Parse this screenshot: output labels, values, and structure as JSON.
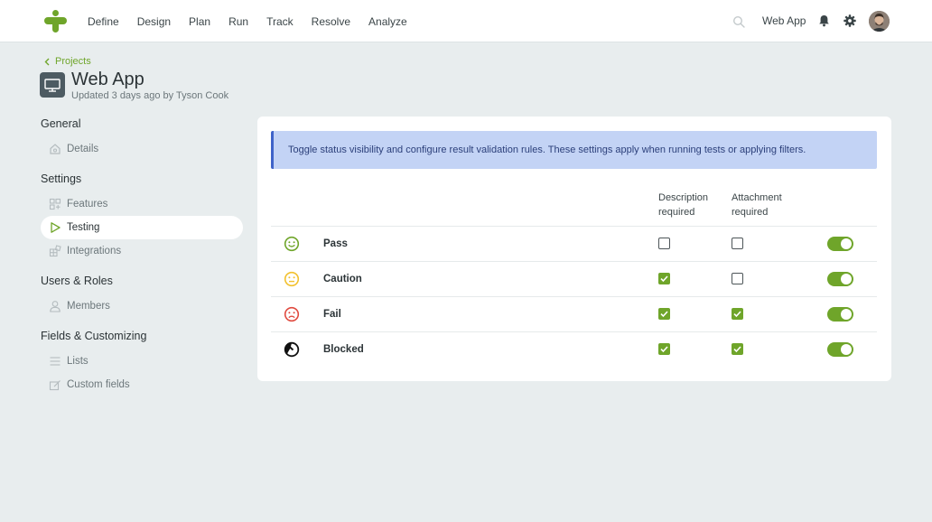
{
  "topnav": {
    "items": [
      "Define",
      "Design",
      "Plan",
      "Run",
      "Track",
      "Resolve",
      "Analyze"
    ],
    "app_label": "Web App"
  },
  "header": {
    "breadcrumb": "Projects",
    "title": "Web App",
    "subtitle": "Updated 3 days ago by Tyson Cook"
  },
  "sidebar": {
    "sections": [
      {
        "title": "General",
        "items": [
          {
            "label": "Details",
            "icon": "home-icon"
          }
        ]
      },
      {
        "title": "Settings",
        "items": [
          {
            "label": "Features",
            "icon": "features-icon"
          },
          {
            "label": "Testing",
            "icon": "play-icon",
            "active": true
          },
          {
            "label": "Integrations",
            "icon": "integrations-icon"
          }
        ]
      },
      {
        "title": "Users & Roles",
        "items": [
          {
            "label": "Members",
            "icon": "user-icon"
          }
        ]
      },
      {
        "title": "Fields & Customizing",
        "items": [
          {
            "label": "Lists",
            "icon": "list-icon"
          },
          {
            "label": "Custom fields",
            "icon": "custom-field-icon"
          }
        ]
      }
    ]
  },
  "main": {
    "info_text": "Toggle status visibility and configure result validation rules. These settings apply when running tests or applying filters.",
    "columns": {
      "description": [
        "Description",
        "required"
      ],
      "attachment": [
        "Attachment",
        "required"
      ]
    },
    "statuses": [
      {
        "label": "Pass",
        "icon": "pass-smiley-icon",
        "color": "#6fa52a",
        "description_required": false,
        "attachment_required": false,
        "enabled": true
      },
      {
        "label": "Caution",
        "icon": "caution-neutral-icon",
        "color": "#f2c12e",
        "description_required": true,
        "attachment_required": false,
        "enabled": true
      },
      {
        "label": "Fail",
        "icon": "fail-sad-icon",
        "color": "#e04a3f",
        "description_required": true,
        "attachment_required": true,
        "enabled": true
      },
      {
        "label": "Blocked",
        "icon": "blocked-icon",
        "color": "#111111",
        "description_required": true,
        "attachment_required": true,
        "enabled": true
      }
    ]
  },
  "colors": {
    "accent": "#6fa52a",
    "info_bg": "#c3d3f5",
    "info_border": "#3f63c9",
    "page_bg": "#e8edee"
  }
}
